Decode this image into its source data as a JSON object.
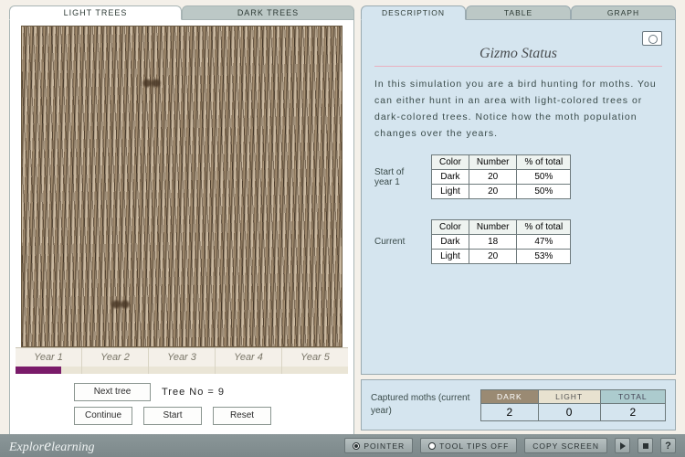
{
  "left": {
    "tabs": [
      "Light Trees",
      "Dark Trees"
    ],
    "active_tab": 0,
    "years": [
      "Year 1",
      "Year 2",
      "Year 3",
      "Year 4",
      "Year 5"
    ],
    "progress_year": 1,
    "progress_fill_pct": 14,
    "next_tree_label": "Next tree",
    "tree_no_label": "Tree No = 9",
    "continue_label": "Continue",
    "start_label": "Start",
    "reset_label": "Reset"
  },
  "right": {
    "tabs": [
      "Description",
      "Table",
      "Graph"
    ],
    "active_tab": 0,
    "status_title": "Gizmo Status",
    "description": "In this simulation you are a bird hunting for moths. You can either hunt in an area with light-colored trees or dark-colored trees. Notice how the moth population changes over the years.",
    "start_label": "Start of year 1",
    "current_label": "Current",
    "headers": [
      "Color",
      "Number",
      "% of total"
    ],
    "start_rows": [
      {
        "color": "Dark",
        "number": "20",
        "pct": "50%"
      },
      {
        "color": "Light",
        "number": "20",
        "pct": "50%"
      }
    ],
    "current_rows": [
      {
        "color": "Dark",
        "number": "18",
        "pct": "47%"
      },
      {
        "color": "Light",
        "number": "20",
        "pct": "53%"
      }
    ]
  },
  "captured": {
    "label": "Captured moths (current year)",
    "headers": [
      "DARK",
      "LIGHT",
      "TOTAL"
    ],
    "values": [
      "2",
      "0",
      "2"
    ]
  },
  "bottombar": {
    "brand_a": "Explor",
    "brand_b": "e",
    "brand_c": "learning",
    "pointer": "POINTER",
    "tooltips": "TOOL TIPS OFF",
    "copyscreen": "COPY SCREEN"
  }
}
